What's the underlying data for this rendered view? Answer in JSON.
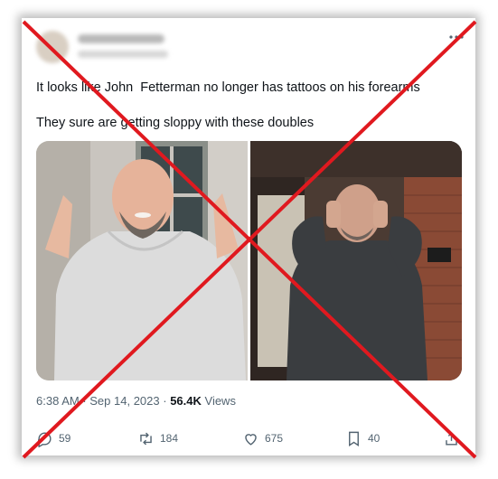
{
  "tweet": {
    "text_line1": "It looks like John  Fetterman no longer has tattoos on his forearms",
    "text_line2": "They sure are getting sloppy with these doubles",
    "time": "6:38 AM",
    "date": "Sep 14, 2023",
    "views_count": "56.4K",
    "views_label": " Views",
    "separator": " · "
  },
  "actions": {
    "reply_count": "59",
    "retweet_count": "184",
    "like_count": "675",
    "bookmark_count": "40"
  },
  "icons": [
    "more-icon",
    "reply-icon",
    "retweet-icon",
    "like-icon",
    "bookmark-icon",
    "share-icon"
  ],
  "colors": {
    "text": "#0f1419",
    "muted": "#536471",
    "overlay_x": "#e0191f"
  }
}
